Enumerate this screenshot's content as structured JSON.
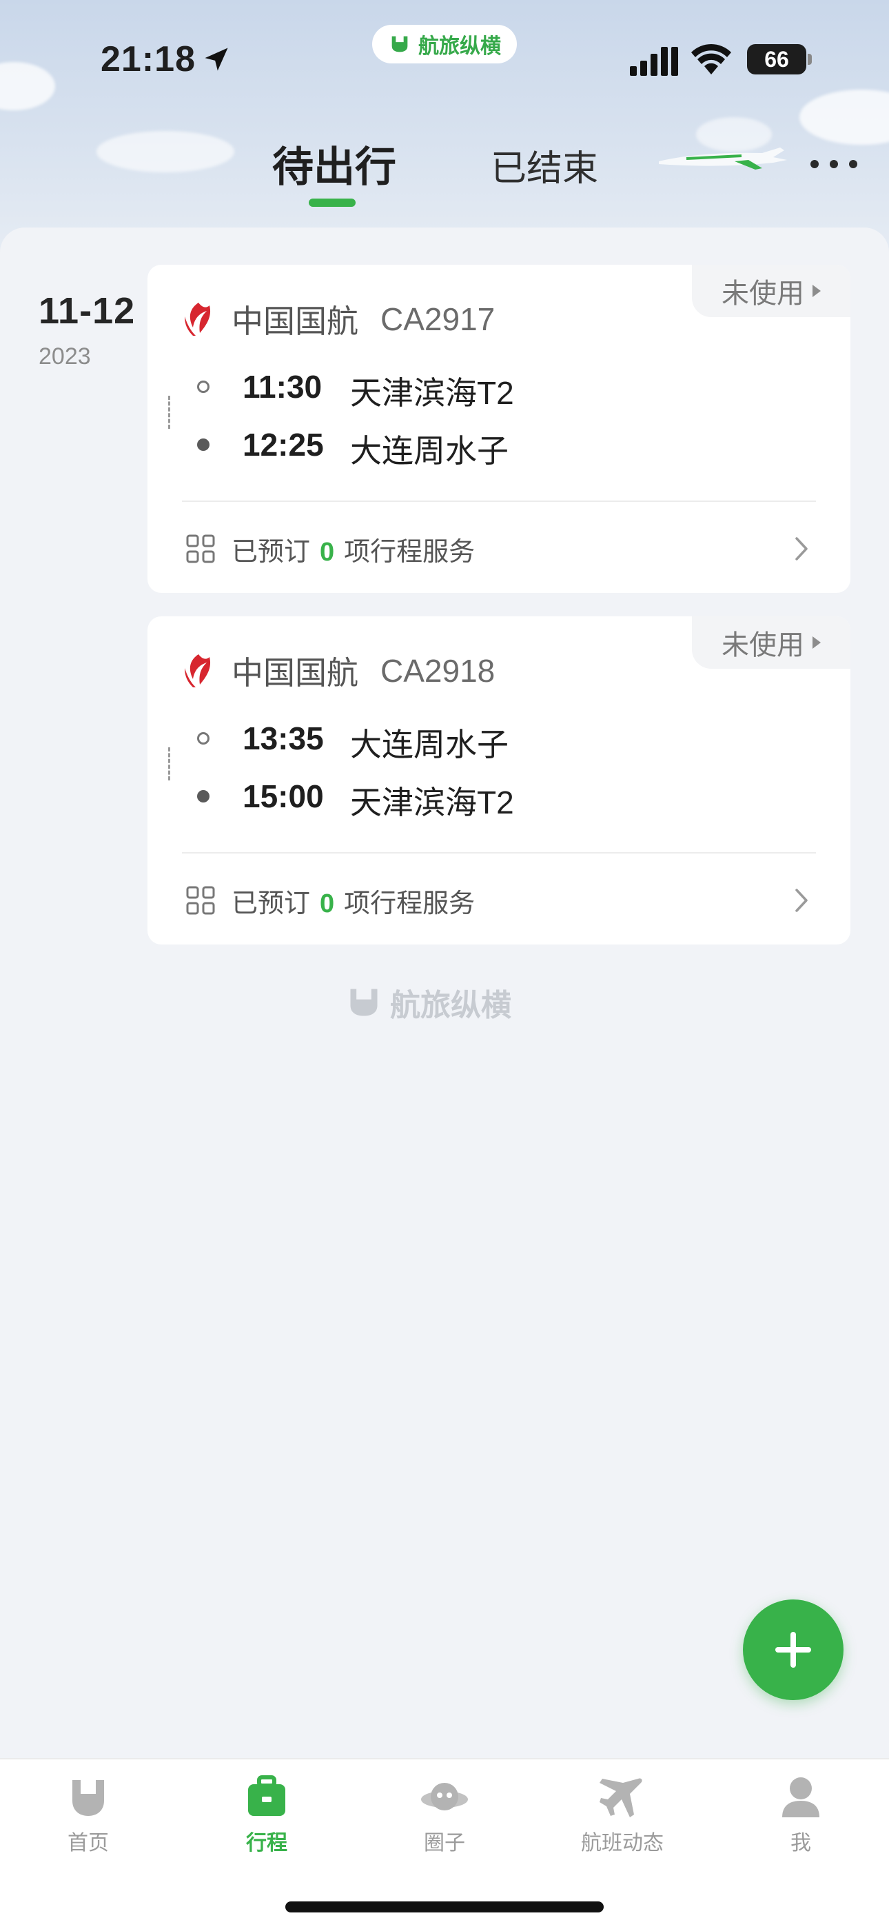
{
  "status_bar": {
    "time": "21:18",
    "battery": "66"
  },
  "brand": {
    "name": "航旅纵横"
  },
  "header": {
    "tabs": [
      {
        "label": "待出行",
        "active": true
      },
      {
        "label": "已结束",
        "active": false
      }
    ]
  },
  "trip_group": {
    "date": "11-12",
    "year": "2023"
  },
  "flights": [
    {
      "airline": "中国国航",
      "flight_no": "CA2917",
      "status": "未使用",
      "depart_time": "11:30",
      "depart_place": "天津滨海T2",
      "arrive_time": "12:25",
      "arrive_place": "大连周水子",
      "service_prefix": "已预订",
      "service_count": "0",
      "service_suffix": "项行程服务"
    },
    {
      "airline": "中国国航",
      "flight_no": "CA2918",
      "status": "未使用",
      "depart_time": "13:35",
      "depart_place": "大连周水子",
      "arrive_time": "15:00",
      "arrive_place": "天津滨海T2",
      "service_prefix": "已预订",
      "service_count": "0",
      "service_suffix": "项行程服务"
    }
  ],
  "footer_logo": "航旅纵横",
  "tabbar": [
    {
      "label": "首页",
      "icon": "home-logo-icon",
      "active": false
    },
    {
      "label": "行程",
      "icon": "suitcase-icon",
      "active": true
    },
    {
      "label": "圈子",
      "icon": "planet-icon",
      "active": false
    },
    {
      "label": "航班动态",
      "icon": "plane-icon",
      "active": false
    },
    {
      "label": "我",
      "icon": "person-icon",
      "active": false
    }
  ],
  "colors": {
    "accent": "#38b24a",
    "airline_red": "#d7262f",
    "background": "#f1f3f7"
  }
}
